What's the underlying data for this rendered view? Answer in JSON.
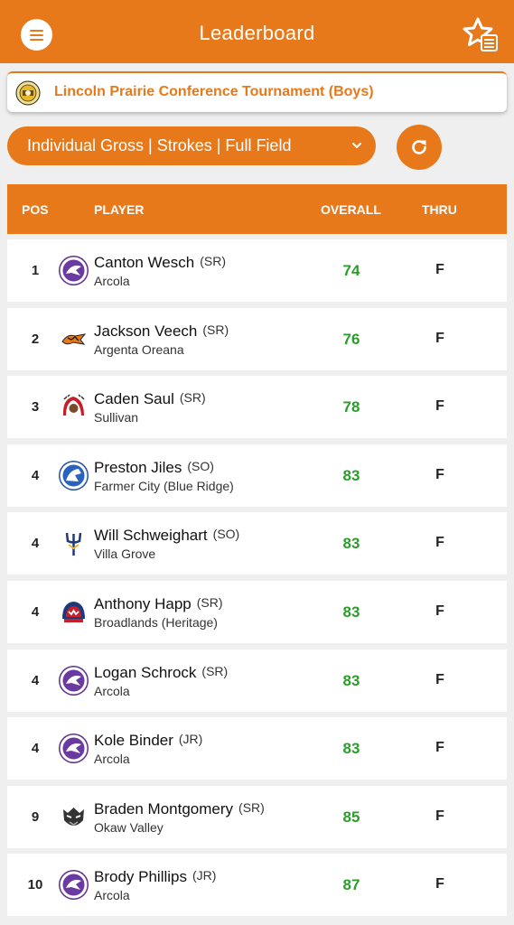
{
  "header": {
    "title": "Leaderboard",
    "menu_icon": "hamburger-icon",
    "favorite_icon": "star-list-icon"
  },
  "tournament": {
    "name": "Lincoln Prairie Conference Tournament (Boys)"
  },
  "view_select": {
    "value": "Individual Gross | Strokes | Full Field"
  },
  "colors": {
    "accent": "#e7791b",
    "score": "#2a9d2a"
  },
  "table": {
    "headers": {
      "pos": "POS",
      "player": "PLAYER",
      "overall": "OVERALL",
      "thru": "THRU"
    },
    "rows": [
      {
        "pos": "1",
        "name": "Canton Wesch",
        "year": "(SR)",
        "school": "Arcola",
        "overall": "74",
        "thru": "F"
      },
      {
        "pos": "2",
        "name": "Jackson Veech",
        "year": "(SR)",
        "school": "Argenta Oreana",
        "overall": "76",
        "thru": "F"
      },
      {
        "pos": "3",
        "name": "Caden Saul",
        "year": "(SR)",
        "school": "Sullivan",
        "overall": "78",
        "thru": "F"
      },
      {
        "pos": "4",
        "name": "Preston Jiles",
        "year": "(SO)",
        "school": "Farmer City (Blue Ridge)",
        "overall": "83",
        "thru": "F"
      },
      {
        "pos": "4",
        "name": "Will Schweighart",
        "year": "(SO)",
        "school": "Villa Grove",
        "overall": "83",
        "thru": "F"
      },
      {
        "pos": "4",
        "name": "Anthony Happ",
        "year": "(SR)",
        "school": "Broadlands (Heritage)",
        "overall": "83",
        "thru": "F"
      },
      {
        "pos": "4",
        "name": "Logan Schrock",
        "year": "(SR)",
        "school": "Arcola",
        "overall": "83",
        "thru": "F"
      },
      {
        "pos": "4",
        "name": "Kole Binder",
        "year": "(JR)",
        "school": "Arcola",
        "overall": "83",
        "thru": "F"
      },
      {
        "pos": "9",
        "name": "Braden Montgomery",
        "year": "(SR)",
        "school": "Okaw Valley",
        "overall": "85",
        "thru": "F"
      },
      {
        "pos": "10",
        "name": "Brody Phillips",
        "year": "(JR)",
        "school": "Arcola",
        "overall": "87",
        "thru": "F"
      }
    ]
  }
}
